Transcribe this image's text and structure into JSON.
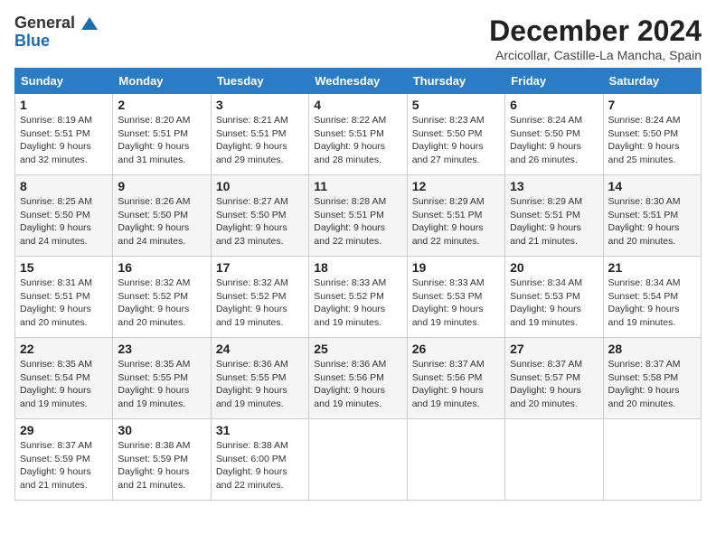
{
  "logo": {
    "line1": "General",
    "line2": "Blue"
  },
  "title": "December 2024",
  "location": "Arcicollar, Castille-La Mancha, Spain",
  "weekdays": [
    "Sunday",
    "Monday",
    "Tuesday",
    "Wednesday",
    "Thursday",
    "Friday",
    "Saturday"
  ],
  "weeks": [
    [
      {
        "day": "1",
        "sunrise": "8:19 AM",
        "sunset": "5:51 PM",
        "daylight": "9 hours and 32 minutes."
      },
      {
        "day": "2",
        "sunrise": "8:20 AM",
        "sunset": "5:51 PM",
        "daylight": "9 hours and 31 minutes."
      },
      {
        "day": "3",
        "sunrise": "8:21 AM",
        "sunset": "5:51 PM",
        "daylight": "9 hours and 29 minutes."
      },
      {
        "day": "4",
        "sunrise": "8:22 AM",
        "sunset": "5:51 PM",
        "daylight": "9 hours and 28 minutes."
      },
      {
        "day": "5",
        "sunrise": "8:23 AM",
        "sunset": "5:50 PM",
        "daylight": "9 hours and 27 minutes."
      },
      {
        "day": "6",
        "sunrise": "8:24 AM",
        "sunset": "5:50 PM",
        "daylight": "9 hours and 26 minutes."
      },
      {
        "day": "7",
        "sunrise": "8:24 AM",
        "sunset": "5:50 PM",
        "daylight": "9 hours and 25 minutes."
      }
    ],
    [
      {
        "day": "8",
        "sunrise": "8:25 AM",
        "sunset": "5:50 PM",
        "daylight": "9 hours and 24 minutes."
      },
      {
        "day": "9",
        "sunrise": "8:26 AM",
        "sunset": "5:50 PM",
        "daylight": "9 hours and 24 minutes."
      },
      {
        "day": "10",
        "sunrise": "8:27 AM",
        "sunset": "5:50 PM",
        "daylight": "9 hours and 23 minutes."
      },
      {
        "day": "11",
        "sunrise": "8:28 AM",
        "sunset": "5:51 PM",
        "daylight": "9 hours and 22 minutes."
      },
      {
        "day": "12",
        "sunrise": "8:29 AM",
        "sunset": "5:51 PM",
        "daylight": "9 hours and 22 minutes."
      },
      {
        "day": "13",
        "sunrise": "8:29 AM",
        "sunset": "5:51 PM",
        "daylight": "9 hours and 21 minutes."
      },
      {
        "day": "14",
        "sunrise": "8:30 AM",
        "sunset": "5:51 PM",
        "daylight": "9 hours and 20 minutes."
      }
    ],
    [
      {
        "day": "15",
        "sunrise": "8:31 AM",
        "sunset": "5:51 PM",
        "daylight": "9 hours and 20 minutes."
      },
      {
        "day": "16",
        "sunrise": "8:32 AM",
        "sunset": "5:52 PM",
        "daylight": "9 hours and 20 minutes."
      },
      {
        "day": "17",
        "sunrise": "8:32 AM",
        "sunset": "5:52 PM",
        "daylight": "9 hours and 19 minutes."
      },
      {
        "day": "18",
        "sunrise": "8:33 AM",
        "sunset": "5:52 PM",
        "daylight": "9 hours and 19 minutes."
      },
      {
        "day": "19",
        "sunrise": "8:33 AM",
        "sunset": "5:53 PM",
        "daylight": "9 hours and 19 minutes."
      },
      {
        "day": "20",
        "sunrise": "8:34 AM",
        "sunset": "5:53 PM",
        "daylight": "9 hours and 19 minutes."
      },
      {
        "day": "21",
        "sunrise": "8:34 AM",
        "sunset": "5:54 PM",
        "daylight": "9 hours and 19 minutes."
      }
    ],
    [
      {
        "day": "22",
        "sunrise": "8:35 AM",
        "sunset": "5:54 PM",
        "daylight": "9 hours and 19 minutes."
      },
      {
        "day": "23",
        "sunrise": "8:35 AM",
        "sunset": "5:55 PM",
        "daylight": "9 hours and 19 minutes."
      },
      {
        "day": "24",
        "sunrise": "8:36 AM",
        "sunset": "5:55 PM",
        "daylight": "9 hours and 19 minutes."
      },
      {
        "day": "25",
        "sunrise": "8:36 AM",
        "sunset": "5:56 PM",
        "daylight": "9 hours and 19 minutes."
      },
      {
        "day": "26",
        "sunrise": "8:37 AM",
        "sunset": "5:56 PM",
        "daylight": "9 hours and 19 minutes."
      },
      {
        "day": "27",
        "sunrise": "8:37 AM",
        "sunset": "5:57 PM",
        "daylight": "9 hours and 20 minutes."
      },
      {
        "day": "28",
        "sunrise": "8:37 AM",
        "sunset": "5:58 PM",
        "daylight": "9 hours and 20 minutes."
      }
    ],
    [
      {
        "day": "29",
        "sunrise": "8:37 AM",
        "sunset": "5:59 PM",
        "daylight": "9 hours and 21 minutes."
      },
      {
        "day": "30",
        "sunrise": "8:38 AM",
        "sunset": "5:59 PM",
        "daylight": "9 hours and 21 minutes."
      },
      {
        "day": "31",
        "sunrise": "8:38 AM",
        "sunset": "6:00 PM",
        "daylight": "9 hours and 22 minutes."
      },
      null,
      null,
      null,
      null
    ]
  ]
}
